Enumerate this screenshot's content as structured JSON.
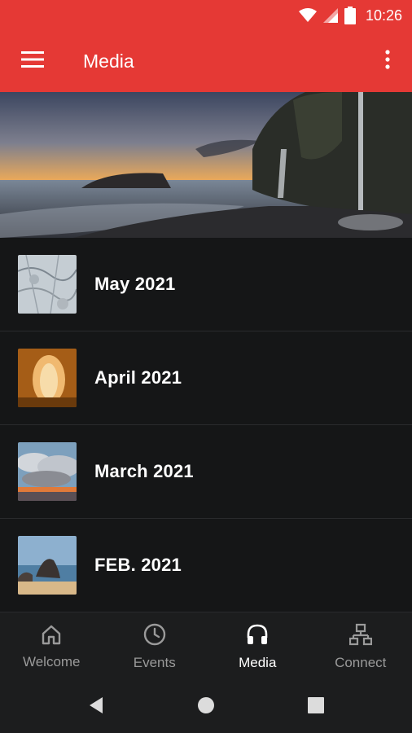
{
  "status_bar": {
    "time": "10:26"
  },
  "app_bar": {
    "title": "Media",
    "menu_icon": "hamburger-menu-icon",
    "overflow_icon": "more-vert-icon"
  },
  "list": {
    "items": [
      {
        "title": "May 2021",
        "thumb": "marble-texture"
      },
      {
        "title": "April 2021",
        "thumb": "cave-opening"
      },
      {
        "title": "March 2021",
        "thumb": "cloudy-sunset"
      },
      {
        "title": "FEB. 2021",
        "thumb": "sea-rocks"
      }
    ]
  },
  "bottom_nav": {
    "items": [
      {
        "label": "Welcome",
        "icon": "home-icon",
        "active": false
      },
      {
        "label": "Events",
        "icon": "clock-icon",
        "active": false
      },
      {
        "label": "Media",
        "icon": "headphones-icon",
        "active": true
      },
      {
        "label": "Connect",
        "icon": "network-icon",
        "active": false
      }
    ]
  },
  "colors": {
    "accent": "#e53935",
    "background": "#151617",
    "nav_bg": "#1c1d1e",
    "inactive": "#9a9a9a"
  }
}
